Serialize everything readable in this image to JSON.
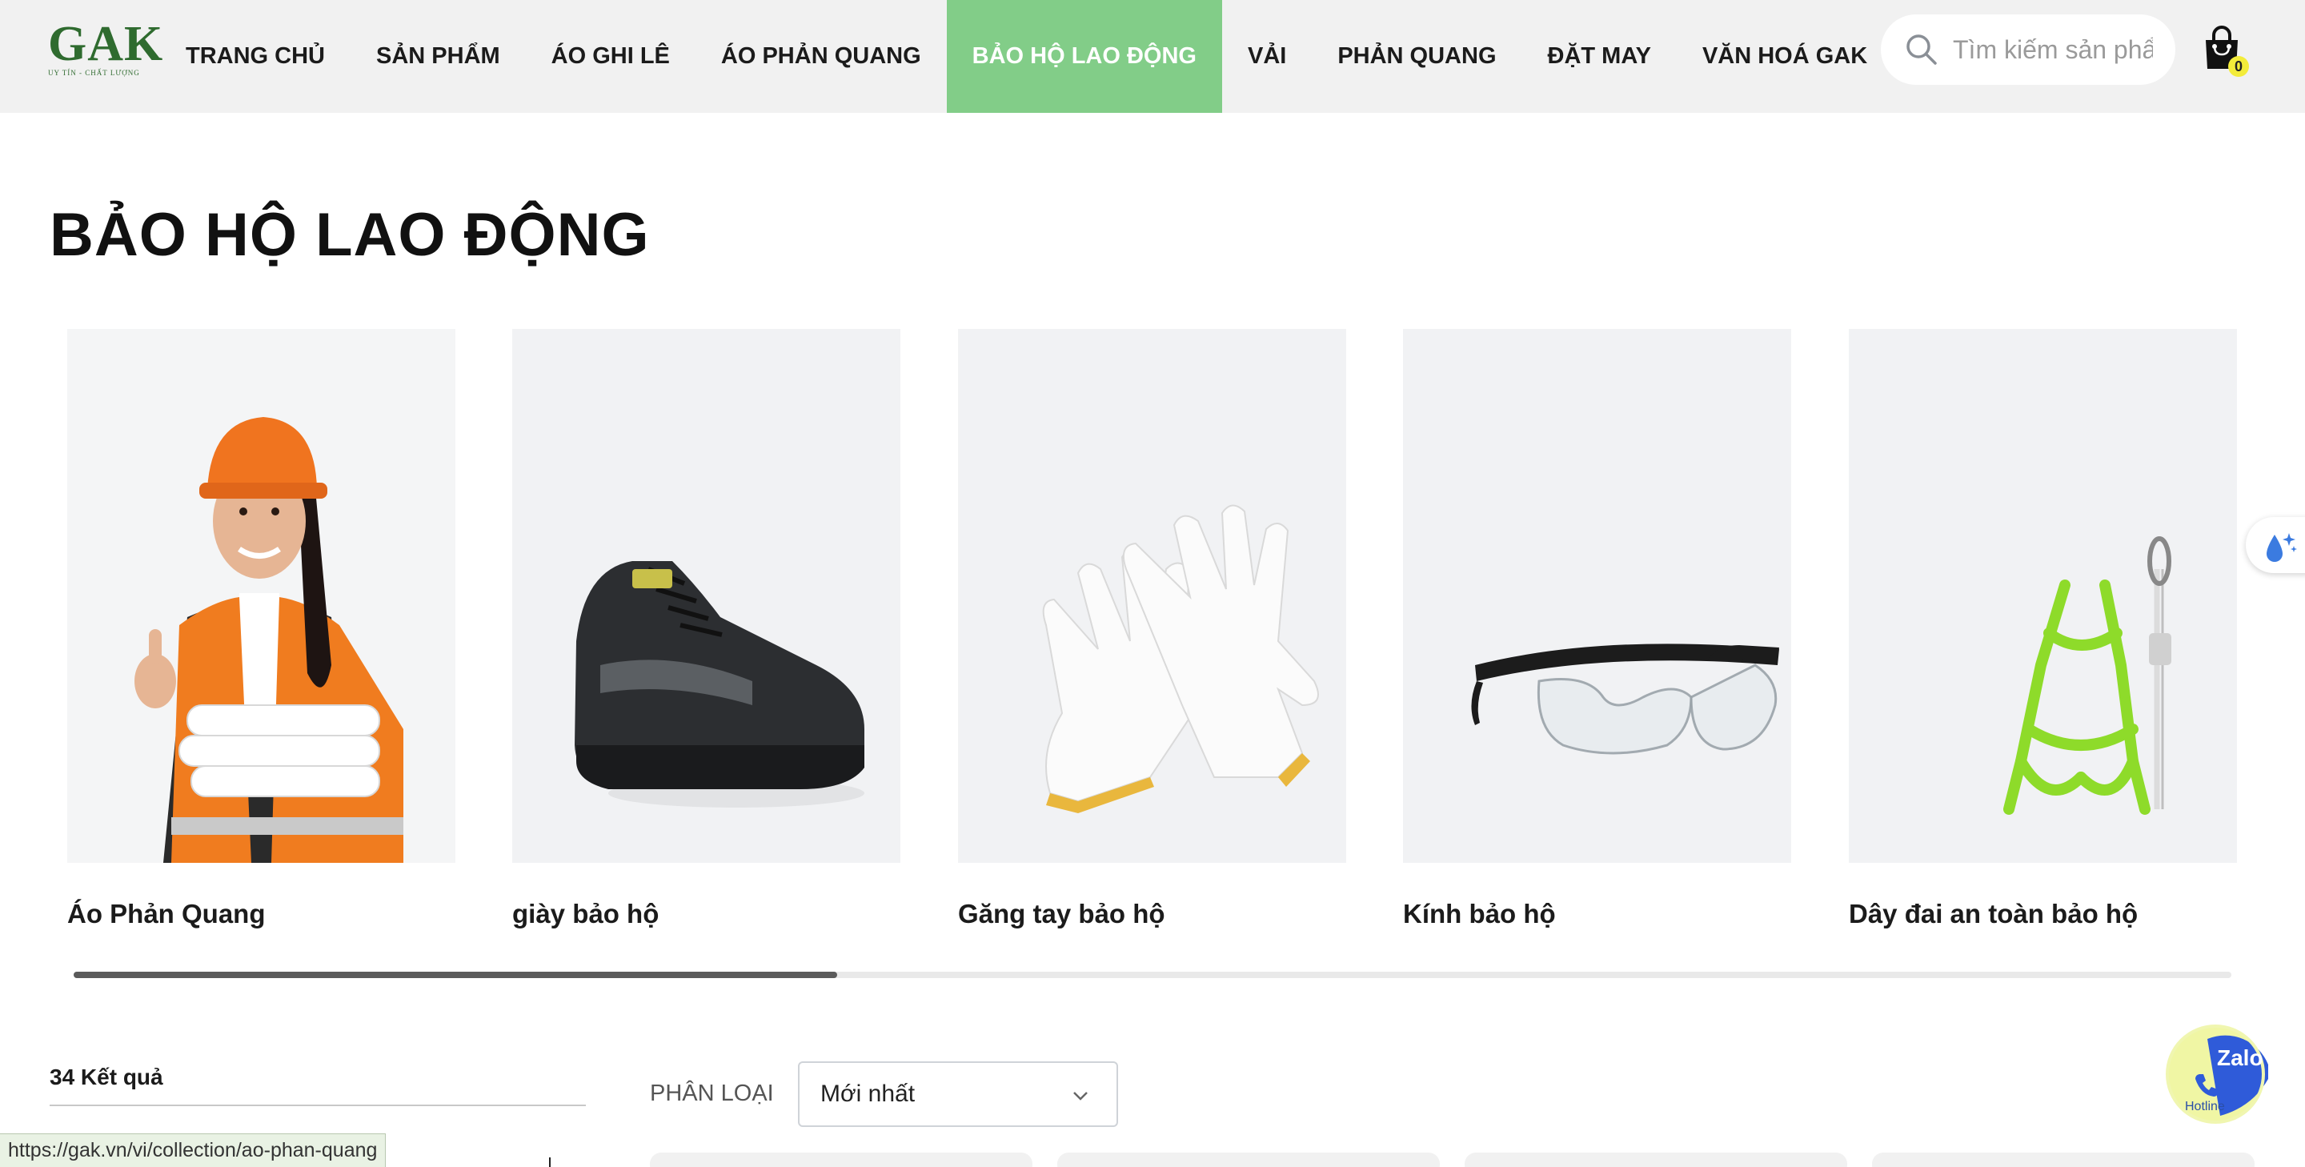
{
  "header": {
    "logo_text": "GAK",
    "logo_tagline": "UY TÍN - CHẤT LƯỢNG",
    "nav": [
      {
        "label": "TRANG CHỦ",
        "active": false
      },
      {
        "label": "SẢN PHẨM",
        "active": false
      },
      {
        "label": "ÁO GHI LÊ",
        "active": false
      },
      {
        "label": "ÁO PHẢN QUANG",
        "active": false
      },
      {
        "label": "BẢO HỘ LAO ĐỘNG",
        "active": true
      },
      {
        "label": "VẢI",
        "active": false
      },
      {
        "label": "PHẢN QUANG",
        "active": false
      },
      {
        "label": "ĐẶT MAY",
        "active": false
      },
      {
        "label": "VĂN HOÁ GAK",
        "active": false
      }
    ],
    "active_color": "#82cd88",
    "search_placeholder": "Tìm kiếm sản phẩm",
    "cart_count": "0",
    "search_icon": "search-icon",
    "cart_icon": "shopping-bag-icon"
  },
  "page": {
    "title": "BẢO HỘ LAO ĐỘNG"
  },
  "categories": [
    {
      "label": "Áo Phản Quang",
      "image": "worker-reflective-vest"
    },
    {
      "label": "giày bảo hộ",
      "image": "safety-shoe"
    },
    {
      "label": "Găng tay bảo hộ",
      "image": "cotton-gloves"
    },
    {
      "label": "Kính bảo hộ",
      "image": "safety-glasses"
    },
    {
      "label": "Dây đai an toàn bảo hộ",
      "image": "safety-harness"
    }
  ],
  "carousel": {
    "scroll_fraction": 0.354
  },
  "filters": {
    "result_count": "34 Kết quả",
    "sort_label": "PHÂN LOẠI",
    "sort_value": "Mới nhất"
  },
  "status_bar": {
    "url": "https://gak.vn/vi/collection/ao-phan-quang"
  },
  "widgets": {
    "zalo_label": "Zalo",
    "hotline_label": "Hotline"
  }
}
